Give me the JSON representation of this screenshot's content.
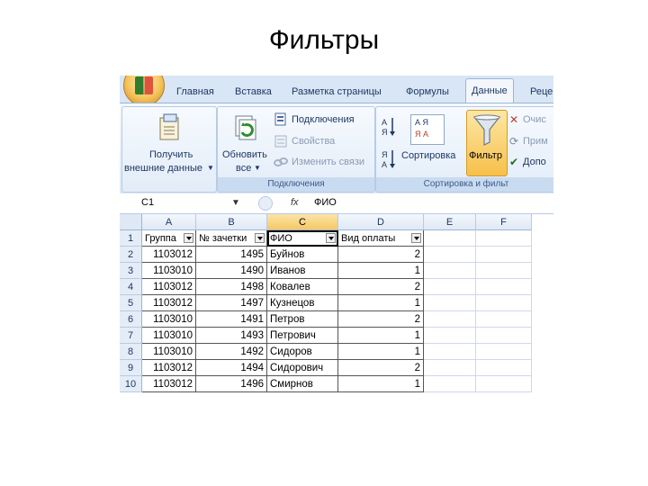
{
  "slide": {
    "title": "Фильтры"
  },
  "ribbon": {
    "tabs": [
      "Главная",
      "Вставка",
      "Разметка страницы",
      "Формулы",
      "Данные",
      "Реце"
    ],
    "get_data_line1": "Получить",
    "get_data_line2": "внешние данные",
    "refresh_line1": "Обновить",
    "refresh_line2": "все",
    "connections": "Подключения",
    "properties": "Свойства",
    "edit_links": "Изменить связи",
    "group_connections": "Подключения",
    "sort": "Сортировка",
    "filter": "Фильтр",
    "clear": "Очис",
    "reapply": "Прим",
    "advanced": "Допо",
    "group_sort_filter": "Сортировка и фильт",
    "sort_az": "А Я",
    "sort_za": "Я А"
  },
  "formula_bar": {
    "name_box": "C1",
    "fx": "fx",
    "value": "ФИО"
  },
  "sheet": {
    "columns": [
      "A",
      "B",
      "C",
      "D",
      "E",
      "F"
    ],
    "selected_column": "C",
    "rows": [
      {
        "n": "1",
        "a": "Группа",
        "b": "№ зачетки",
        "c": "ФИО",
        "d": "Вид оплаты"
      },
      {
        "n": "2",
        "a": "1103012",
        "b": "1495",
        "c": "Буйнов",
        "d": "2"
      },
      {
        "n": "3",
        "a": "1103010",
        "b": "1490",
        "c": "Иванов",
        "d": "1"
      },
      {
        "n": "4",
        "a": "1103012",
        "b": "1498",
        "c": "Ковалев",
        "d": "2"
      },
      {
        "n": "5",
        "a": "1103012",
        "b": "1497",
        "c": "Кузнецов",
        "d": "1"
      },
      {
        "n": "6",
        "a": "1103010",
        "b": "1491",
        "c": "Петров",
        "d": "2"
      },
      {
        "n": "7",
        "a": "1103010",
        "b": "1493",
        "c": "Петрович",
        "d": "1"
      },
      {
        "n": "8",
        "a": "1103010",
        "b": "1492",
        "c": "Сидоров",
        "d": "1"
      },
      {
        "n": "9",
        "a": "1103012",
        "b": "1494",
        "c": "Сидорович",
        "d": "2"
      },
      {
        "n": "10",
        "a": "1103012",
        "b": "1496",
        "c": "Смирнов",
        "d": "1"
      }
    ]
  }
}
